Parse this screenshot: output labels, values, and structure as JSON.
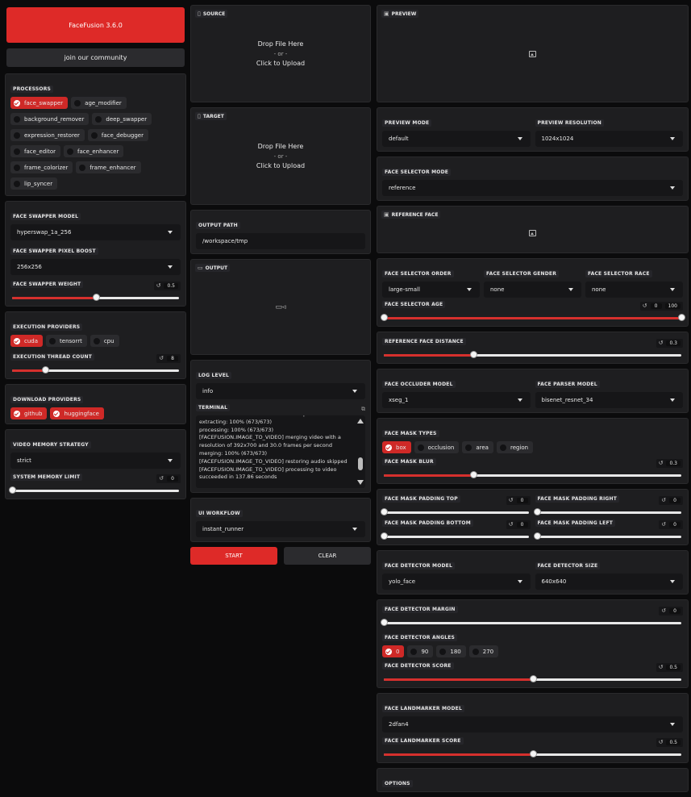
{
  "app": {
    "title_button": "FaceFusion 3.6.0",
    "community_button": "join our community"
  },
  "processors": {
    "label": "PROCESSORS",
    "items": [
      {
        "name": "face_swapper",
        "checked": true
      },
      {
        "name": "age_modifier",
        "checked": false
      },
      {
        "name": "background_remover",
        "checked": false
      },
      {
        "name": "deep_swapper",
        "checked": false
      },
      {
        "name": "expression_restorer",
        "checked": false
      },
      {
        "name": "face_debugger",
        "checked": false
      },
      {
        "name": "face_editor",
        "checked": false
      },
      {
        "name": "face_enhancer",
        "checked": false
      },
      {
        "name": "frame_colorizer",
        "checked": false
      },
      {
        "name": "frame_enhancer",
        "checked": false
      },
      {
        "name": "lip_syncer",
        "checked": false
      }
    ]
  },
  "face_swapper": {
    "model_label": "FACE SWAPPER MODEL",
    "model_value": "hyperswap_1a_256",
    "pixel_boost_label": "FACE SWAPPER PIXEL BOOST",
    "pixel_boost_value": "256x256",
    "weight_label": "FACE SWAPPER WEIGHT",
    "weight_value": "0.5",
    "weight_fraction": 0.5
  },
  "execution": {
    "providers_label": "EXECUTION PROVIDERS",
    "providers": [
      {
        "name": "cuda",
        "checked": true
      },
      {
        "name": "tensorrt",
        "checked": false
      },
      {
        "name": "cpu",
        "checked": false
      }
    ],
    "thread_label": "EXECUTION THREAD COUNT",
    "thread_value": "8",
    "thread_fraction": 0.2
  },
  "download": {
    "label": "DOWNLOAD PROVIDERS",
    "providers": [
      {
        "name": "github",
        "checked": true
      },
      {
        "name": "huggingface",
        "checked": true
      }
    ]
  },
  "memory": {
    "strategy_label": "VIDEO MEMORY STRATEGY",
    "strategy_value": "strict",
    "limit_label": "SYSTEM MEMORY LIMIT",
    "limit_value": "0",
    "limit_fraction": 0
  },
  "source": {
    "label": "SOURCE",
    "drop": "Drop File Here",
    "or": "- or -",
    "click": "Click to Upload"
  },
  "target": {
    "label": "TARGET",
    "drop": "Drop File Here",
    "or": "- or -",
    "click": "Click to Upload"
  },
  "output_path": {
    "label": "OUTPUT PATH",
    "value": "/workspace/tmp"
  },
  "output": {
    "label": "OUTPUT"
  },
  "log_level": {
    "label": "LOG LEVEL",
    "value": "info"
  },
  "terminal": {
    "label": "TERMINAL",
    "lines": [
      "resolution of 392x700 and 30.0 frames per second",
      "extracting: 100% (673/673)",
      "processing: 100% (673/673)",
      "[FACEFUSION.IMAGE_TO_VIDEO] merging video with a",
      "resolution of 392x700 and 30.0 frames per second",
      "merging: 100% (673/673)",
      "[FACEFUSION.IMAGE_TO_VIDEO] restoring audio skipped",
      "[FACEFUSION.IMAGE_TO_VIDEO] processing to video",
      "succeeded in 137.86 seconds"
    ]
  },
  "ui_workflow": {
    "label": "UI WORKFLOW",
    "value": "instant_runner"
  },
  "actions": {
    "start": "START",
    "clear": "CLEAR"
  },
  "preview": {
    "label": "PREVIEW"
  },
  "preview_mode": {
    "label": "PREVIEW MODE",
    "value": "default"
  },
  "preview_resolution": {
    "label": "PREVIEW RESOLUTION",
    "value": "1024x1024"
  },
  "face_selector_mode": {
    "label": "FACE SELECTOR MODE",
    "value": "reference"
  },
  "reference_face": {
    "label": "REFERENCE FACE"
  },
  "face_selector_order": {
    "label": "FACE SELECTOR ORDER",
    "value": "large-small"
  },
  "face_selector_gender": {
    "label": "FACE SELECTOR GENDER",
    "value": "none"
  },
  "face_selector_race": {
    "label": "FACE SELECTOR RACE",
    "value": "none"
  },
  "face_selector_age": {
    "label": "FACE SELECTOR AGE",
    "min": "0",
    "max": "100",
    "min_fraction": 0,
    "max_fraction": 1
  },
  "reference_face_distance": {
    "label": "REFERENCE FACE DISTANCE",
    "value": "0.3",
    "fraction": 0.3
  },
  "face_occluder_model": {
    "label": "FACE OCCLUDER MODEL",
    "value": "xseg_1"
  },
  "face_parser_model": {
    "label": "FACE PARSER MODEL",
    "value": "bisenet_resnet_34"
  },
  "face_mask_types": {
    "label": "FACE MASK TYPES",
    "items": [
      {
        "name": "box",
        "checked": true
      },
      {
        "name": "occlusion",
        "checked": false
      },
      {
        "name": "area",
        "checked": false
      },
      {
        "name": "region",
        "checked": false
      }
    ]
  },
  "face_mask_blur": {
    "label": "FACE MASK BLUR",
    "value": "0.3",
    "fraction": 0.3
  },
  "face_mask_padding": {
    "top_label": "FACE MASK PADDING TOP",
    "top_value": "0",
    "right_label": "FACE MASK PADDING RIGHT",
    "right_value": "0",
    "bottom_label": "FACE MASK PADDING BOTTOM",
    "bottom_value": "0",
    "left_label": "FACE MASK PADDING LEFT",
    "left_value": "0"
  },
  "face_detector_model": {
    "label": "FACE DETECTOR MODEL",
    "value": "yolo_face"
  },
  "face_detector_size": {
    "label": "FACE DETECTOR SIZE",
    "value": "640x640"
  },
  "face_detector_margin": {
    "label": "FACE DETECTOR MARGIN",
    "value": "0",
    "fraction": 0
  },
  "face_detector_angles": {
    "label": "FACE DETECTOR ANGLES",
    "items": [
      {
        "name": "0",
        "checked": true
      },
      {
        "name": "90",
        "checked": false
      },
      {
        "name": "180",
        "checked": false
      },
      {
        "name": "270",
        "checked": false
      }
    ]
  },
  "face_detector_score": {
    "label": "FACE DETECTOR SCORE",
    "value": "0.5",
    "fraction": 0.5
  },
  "face_landmarker_model": {
    "label": "FACE LANDMARKER MODEL",
    "value": "2dfan4"
  },
  "face_landmarker_score": {
    "label": "FACE LANDMARKER SCORE",
    "value": "0.5",
    "fraction": 0.5
  },
  "options": {
    "label": "OPTIONS"
  },
  "colors": {
    "accent": "#de2a28",
    "panel": "#1e1e20",
    "background": "#0b0b0c"
  },
  "icons": {
    "upload": "file-icon",
    "output": "video-icon",
    "image": "image-icon",
    "reset": "reset-icon",
    "copy": "copy-icon"
  }
}
